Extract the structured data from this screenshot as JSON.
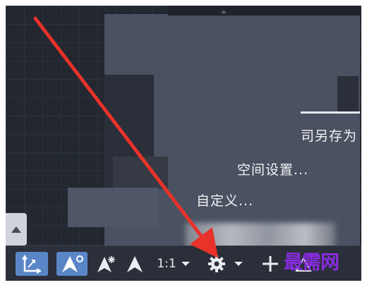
{
  "menu": {
    "item_save_as": "司另存为",
    "item_space_settings": "空间设置...",
    "item_custom": "自定义..."
  },
  "toolbar": {
    "ratio_label": "1:1",
    "buttons": [
      "ucs-axes-icon",
      "snap-magnet-icon",
      "snap-star-icon",
      "snap-tracking-icon",
      "ratio-dropdown",
      "gear-icon",
      "plus-icon",
      "annotation-icon"
    ]
  },
  "watermark": {
    "text": "最需网"
  },
  "colors": {
    "background": "#1f232b",
    "popup": "#4a5161",
    "toolbar": "#2a2f39",
    "active_button": "#5a86c7",
    "arrow": "#e8322a",
    "watermark": "#8a2be2"
  }
}
